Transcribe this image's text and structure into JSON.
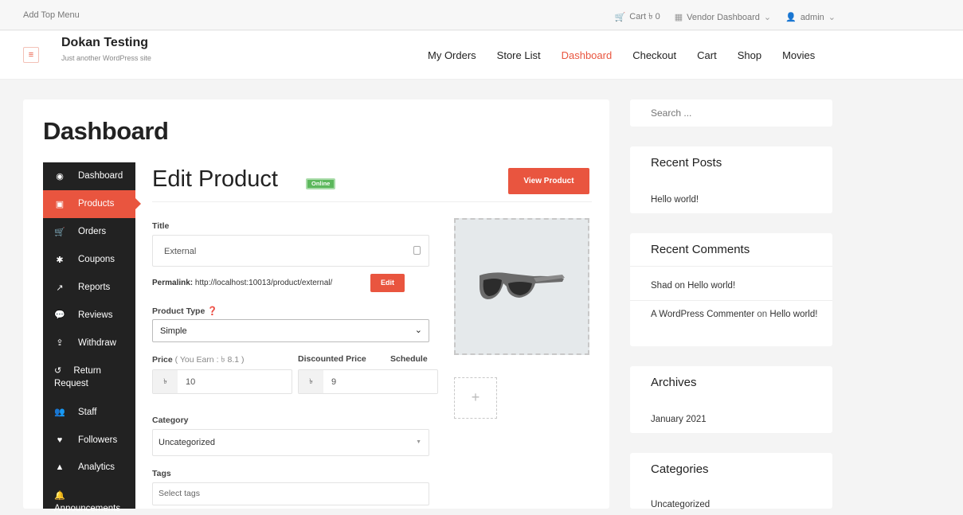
{
  "topbar": {
    "left_link": "Add Top Menu",
    "cart": "Cart ৳ 0",
    "vendor_dashboard": "Vendor Dashboard",
    "user": "admin"
  },
  "header": {
    "site_title": "Dokan Testing",
    "tagline": "Just another WordPress site",
    "nav": [
      "My Orders",
      "Store List",
      "Dashboard",
      "Checkout",
      "Cart",
      "Shop",
      "Movies"
    ],
    "active_nav": "Dashboard"
  },
  "page": {
    "title": "Dashboard"
  },
  "sidebar": {
    "items": [
      {
        "label": "Dashboard",
        "icon": "dashboard-icon",
        "active": false
      },
      {
        "label": "Products",
        "icon": "briefcase-icon",
        "active": true
      },
      {
        "label": "Orders",
        "icon": "cart-icon",
        "active": false
      },
      {
        "label": "Coupons",
        "icon": "gift-icon",
        "active": false
      },
      {
        "label": "Reports",
        "icon": "line-chart-icon",
        "active": false
      },
      {
        "label": "Reviews",
        "icon": "comments-icon",
        "active": false
      },
      {
        "label": "Withdraw",
        "icon": "upload-icon",
        "active": false
      },
      {
        "label": "Return Request",
        "icon": "undo-icon",
        "active": false
      },
      {
        "label": "Staff",
        "icon": "users-icon",
        "active": false
      },
      {
        "label": "Followers",
        "icon": "heart-icon",
        "active": false
      },
      {
        "label": "Analytics",
        "icon": "area-chart-icon",
        "active": false
      },
      {
        "label": "Announcements",
        "icon": "bell-icon",
        "active": false
      }
    ]
  },
  "product": {
    "heading": "Edit Product",
    "status_badge": "Online",
    "view_button": "View Product",
    "title_label": "Title",
    "title_value": "External",
    "permalink_label": "Permalink:",
    "permalink_url": "http://localhost:10013/product/external/",
    "permalink_edit": "Edit",
    "type_label": "Product Type",
    "type_value": "Simple",
    "price_label": "Price",
    "price_earn": "( You Earn : ৳ 8.1 )",
    "currency": "৳",
    "price_value": "10",
    "discount_label": "Discounted Price",
    "discount_value": "9",
    "schedule_label": "Schedule",
    "category_label": "Category",
    "category_value": "Uncategorized",
    "tags_label": "Tags",
    "tags_placeholder": "Select tags"
  },
  "widgets": {
    "search_placeholder": "Search ...",
    "recent_posts_title": "Recent Posts",
    "recent_posts": [
      "Hello world!"
    ],
    "recent_comments_title": "Recent Comments",
    "comment1_author": "Shad",
    "comment1_on": "on",
    "comment1_post": "Hello world!",
    "comment2_author": "A WordPress Commenter",
    "comment2_on": "on",
    "comment2_post": "Hello world!",
    "archives_title": "Archives",
    "archives": [
      "January 2021"
    ],
    "categories_title": "Categories",
    "categories": [
      "Uncategorized"
    ]
  },
  "colors": {
    "accent": "#e9553f",
    "sidebar_bg": "#222222",
    "online_badge": "#5cb85c"
  }
}
